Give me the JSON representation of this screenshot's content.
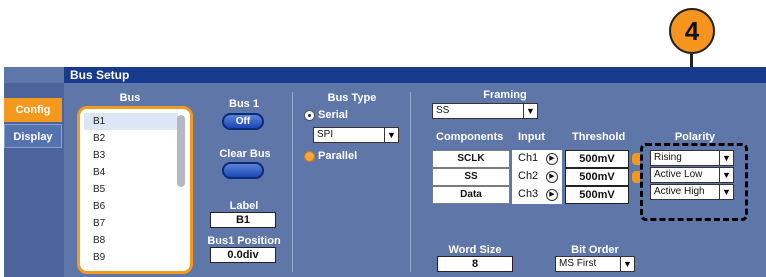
{
  "callout": {
    "number": "4"
  },
  "window": {
    "title": "Bus Setup"
  },
  "side_tabs": [
    {
      "label": "Config",
      "active": true
    },
    {
      "label": "Display",
      "active": false
    }
  ],
  "bus_list": {
    "header": "Bus",
    "items": [
      "B1",
      "B2",
      "B3",
      "B4",
      "B5",
      "B6",
      "B7",
      "B8",
      "B9"
    ],
    "selected": "B1"
  },
  "bus1": {
    "label": "Bus 1",
    "toggle": "Off"
  },
  "clear_bus": {
    "label": "Clear Bus"
  },
  "label_field": {
    "label": "Label",
    "value": "B1"
  },
  "position": {
    "label": "Bus1 Position",
    "value": "0.0div"
  },
  "bus_type": {
    "header": "Bus Type",
    "serial_label": "Serial",
    "serial_protocol": "SPI",
    "parallel_label": "Parallel",
    "selected": "Serial"
  },
  "framing": {
    "header": "Framing",
    "value": "SS"
  },
  "components": {
    "headers": {
      "components": "Components",
      "input": "Input",
      "threshold": "Threshold"
    },
    "rows": [
      {
        "name": "SCLK",
        "input": "Ch1",
        "threshold": "500mV"
      },
      {
        "name": "SS",
        "input": "Ch2",
        "threshold": "500mV"
      },
      {
        "name": "Data",
        "input": "Ch3",
        "threshold": "500mV"
      }
    ]
  },
  "polarity": {
    "header": "Polarity",
    "values": [
      "Rising",
      "Active Low",
      "Active High"
    ]
  },
  "word_size": {
    "label": "Word Size",
    "value": "8"
  },
  "bit_order": {
    "label": "Bit Order",
    "value": "MS First"
  },
  "colors": {
    "accent": "#f39a1e",
    "title_bar": "#173a8c",
    "panel": "#5f76a8"
  },
  "icons": {
    "dropdown": "chevron-down-icon",
    "play": "play-icon"
  }
}
